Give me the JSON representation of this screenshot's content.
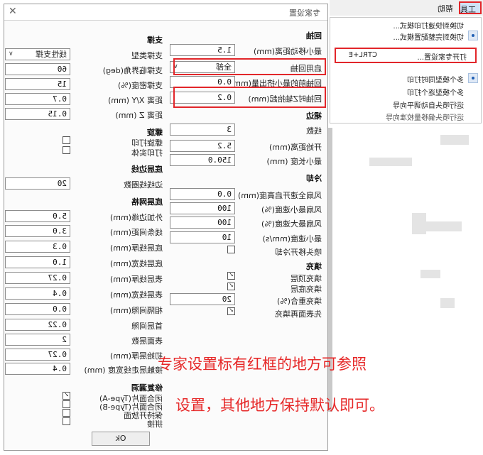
{
  "dialog": {
    "title": "专家设置",
    "retract": {
      "title": "回抽",
      "rows": [
        {
          "label": "最小移动距离(mm)",
          "value": "1.5"
        },
        {
          "label": "启用回抽",
          "value": "全部"
        },
        {
          "label": "回抽前的最小挤出量(mm)",
          "value": "0.0"
        },
        {
          "label": "回抽时Z轴抬起(mm)",
          "value": "0.2"
        }
      ]
    },
    "skirt": {
      "title": "裙边",
      "rows": [
        {
          "label": "线数",
          "value": "3"
        },
        {
          "label": "开始距离(mm)",
          "value": "5.2"
        },
        {
          "label": "最小长度 (mm)",
          "value": "150.0"
        }
      ]
    },
    "cool": {
      "title": "冷却",
      "rows": [
        {
          "label": "风扇全速开启高度(mm)",
          "value": "0.0"
        },
        {
          "label": "风扇最小速度(%)",
          "value": "100"
        },
        {
          "label": "风扇最大速度(%)",
          "value": "100"
        },
        {
          "label": "最小速度(mm/s)",
          "value": "10"
        }
      ],
      "check_label": "喷头移开冷却"
    },
    "fill": {
      "title": "填充",
      "rows": [
        {
          "label": "填充顶层",
          "checked": "✓"
        },
        {
          "label": "填充底层",
          "checked": "✓"
        },
        {
          "label": "填充重合(%)",
          "value": "20"
        },
        {
          "label": "先表面再填充",
          "checked": "✓"
        }
      ]
    },
    "support": {
      "title": "支撑",
      "rows": [
        {
          "label": "支撑类型",
          "value": "线性支撑"
        },
        {
          "label": "支撑临界角(deg)",
          "value": "60"
        },
        {
          "label": "支撑密度(%)",
          "value": "15"
        },
        {
          "label": "距离 X/Y (mm)",
          "value": "0.7"
        },
        {
          "label": "距离 Z (mm)",
          "value": "0.15"
        }
      ]
    },
    "spiral": {
      "title": "螺旋",
      "items": [
        "螺旋打印",
        "打印实体"
      ]
    },
    "brim": {
      "title": "底层边线",
      "rows": [
        {
          "label": "边线线圈数",
          "value": "20"
        }
      ]
    },
    "raft": {
      "title": "底层网格",
      "rows": [
        {
          "label": "外加边缘(mm)",
          "value": "5.0"
        },
        {
          "label": "线条间距(mm)",
          "value": "3.0"
        },
        {
          "label": "底层线厚(mm)",
          "value": "0.3"
        },
        {
          "label": "底层线宽(mm)",
          "value": "1.0"
        },
        {
          "label": "表层线厚(mm)",
          "value": "0.27"
        },
        {
          "label": "表层线宽(mm)",
          "value": "0.4"
        },
        {
          "label": "相隔间隙(mm)",
          "value": "0.0"
        },
        {
          "label": "首层间隙",
          "value": "0.22"
        },
        {
          "label": "表面层数",
          "value": "2"
        },
        {
          "label": "初始层厚(mm)",
          "value": "0.27"
        },
        {
          "label": "接触层走线宽度 (mm)",
          "value": "0.4"
        }
      ]
    },
    "fix": {
      "title": "修复漏洞",
      "items": [
        "闭合面片(Type-A)",
        "闭合面片(Type-B)",
        "保持开放面",
        "拼接"
      ],
      "checks": [
        "✓",
        "",
        "",
        ""
      ]
    },
    "ok_label": "Ok"
  },
  "menu": {
    "tools_label": "工具",
    "help_label": "帮助",
    "items": [
      "切换到快速打印模式...",
      "切换到完整配置模式...",
      "打开专家设置...",
      "CTRL+E",
      "多个模型同时打印",
      "多个模型逐个打印",
      "运行喷头自动调平向导",
      "运行喷头偏移量校准向导"
    ]
  },
  "annotation": {
    "line1": "专家设置标有红框的地方可参照",
    "line2": "设置，其他地方保持默认即可。"
  },
  "colors": {
    "red": "#e2262a",
    "note_red": "#e62828",
    "menu_highlight": "#dfe9f6"
  }
}
